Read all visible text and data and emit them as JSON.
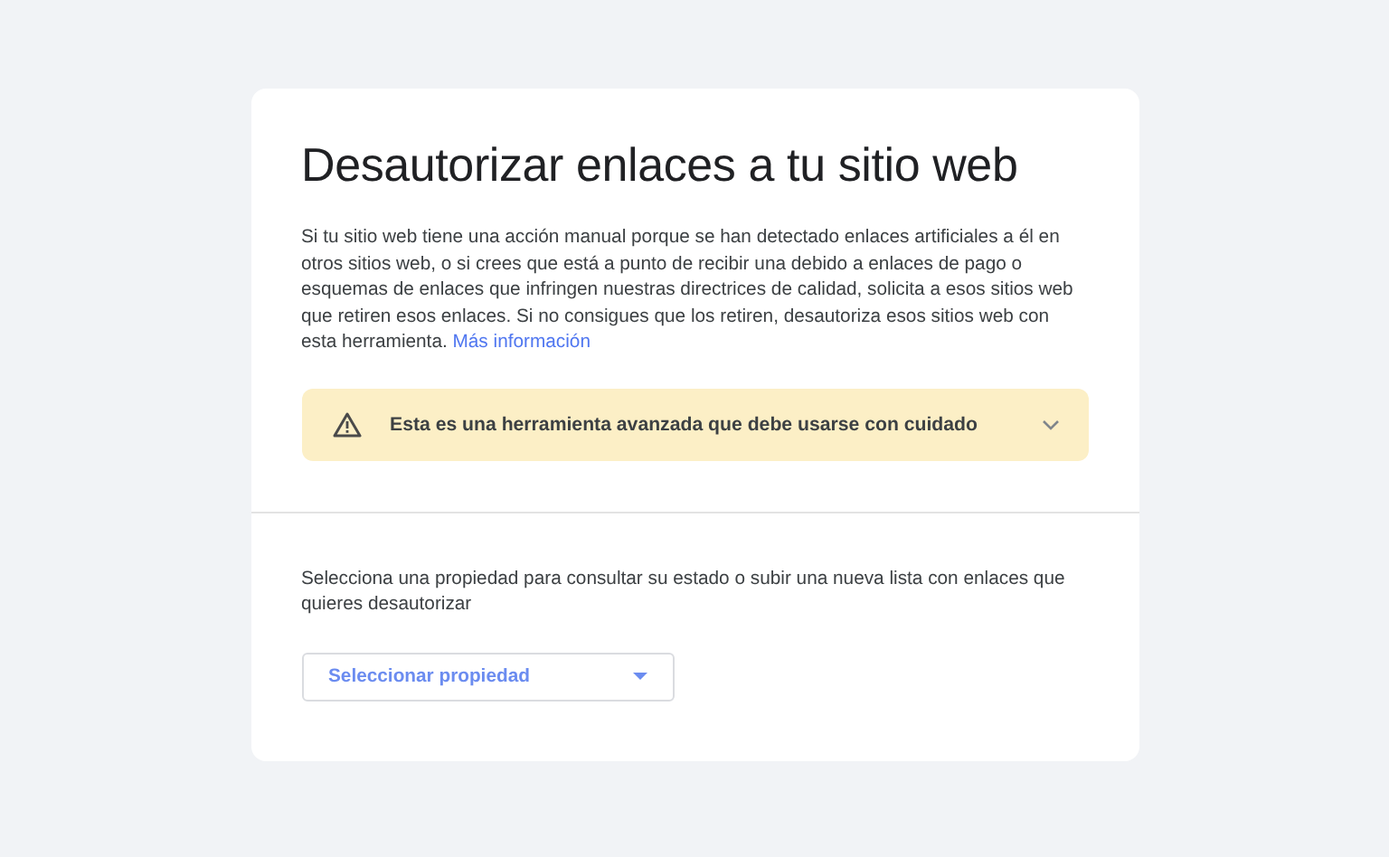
{
  "title": "Desautorizar enlaces a tu sitio web",
  "intro": {
    "text": "Si tu sitio web tiene una acción manual porque se han detectado enlaces artificiales a él en otros sitios web, o si crees que está a punto de recibir una debido a enlaces de pago o esquemas de enlaces que infringen nuestras directrices de calidad, solicita a esos sitios web que retiren esos enlaces. Si no consigues que los retiren, desautoriza esos sitios web con esta herramienta.",
    "link": "Más información"
  },
  "warning": {
    "text": "Esta es una herramienta avanzada que debe usarse con cuidado",
    "expanded": false
  },
  "property": {
    "prompt": "Selecciona una propiedad para consultar su estado o subir una nueva lista con enlaces que quieres desautorizar",
    "dropdown": "Seleccionar propiedad"
  }
}
